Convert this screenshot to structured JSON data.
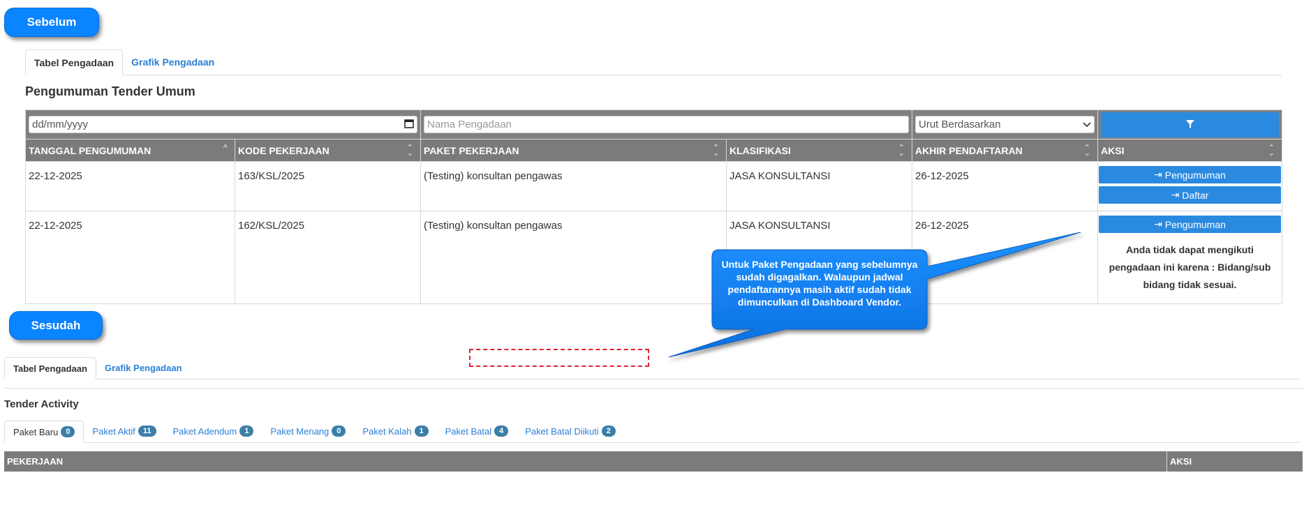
{
  "labels": {
    "before": "Sebelum",
    "after": "Sesudah"
  },
  "tabs_top": [
    "Tabel Pengadaan",
    "Grafik Pengadaan"
  ],
  "title_top": "Pengumuman Tender Umum",
  "filters": {
    "date_placeholder": "dd/mm/yyyy",
    "name_placeholder": "Nama Pengadaan",
    "sort_label": "Urut Berdasarkan"
  },
  "columns": [
    "TANGGAL PENGUMUMAN",
    "KODE PEKERJAAN",
    "PAKET PEKERJAAN",
    "KLASIFIKASI",
    "AKHIR PENDAFTARAN",
    "AKSI"
  ],
  "rows": [
    {
      "tanggal": "22-12-2025",
      "kode": "163/KSL/2025",
      "paket": "(Testing) konsultan pengawas",
      "klasifikasi": "JASA KONSULTANSI",
      "akhir": "26-12-2025"
    },
    {
      "tanggal": "22-12-2025",
      "kode": "162/KSL/2025",
      "paket": "(Testing) konsultan pengawas",
      "klasifikasi": "JASA KONSULTANSI",
      "akhir": "26-12-2025"
    }
  ],
  "actions": {
    "pengumuman": "Pengumuman",
    "daftar": "Daftar"
  },
  "row2_note": "Anda tidak dapat mengikuti pengadaan ini karena : Bidang/sub bidang tidak sesuai.",
  "callout": "Untuk Paket Pengadaan yang sebelumnya sudah digagalkan. Walaupun jadwal pendaftarannya masih aktif sudah tidak dimunculkan di Dashboard Vendor.",
  "tabs_bottom": [
    "Tabel Pengadaan",
    "Grafik Pengadaan"
  ],
  "title_bottom": "Tender Activity",
  "activity_tabs": [
    {
      "label": "Paket Baru",
      "count": "0"
    },
    {
      "label": "Paket Aktif",
      "count": "11"
    },
    {
      "label": "Paket Adendum",
      "count": "1"
    },
    {
      "label": "Paket Menang",
      "count": "0"
    },
    {
      "label": "Paket Kalah",
      "count": "1"
    },
    {
      "label": "Paket Batal",
      "count": "4"
    },
    {
      "label": "Paket Batal Diikuti",
      "count": "2"
    }
  ],
  "bottom_columns": [
    "PEKERJAAN",
    "AKSI"
  ],
  "colors": {
    "accent": "#0a84ff",
    "button": "#2a8ae0",
    "header": "#7b7b7b",
    "badge": "#3b7fa8",
    "dashed": "#e0202a"
  }
}
